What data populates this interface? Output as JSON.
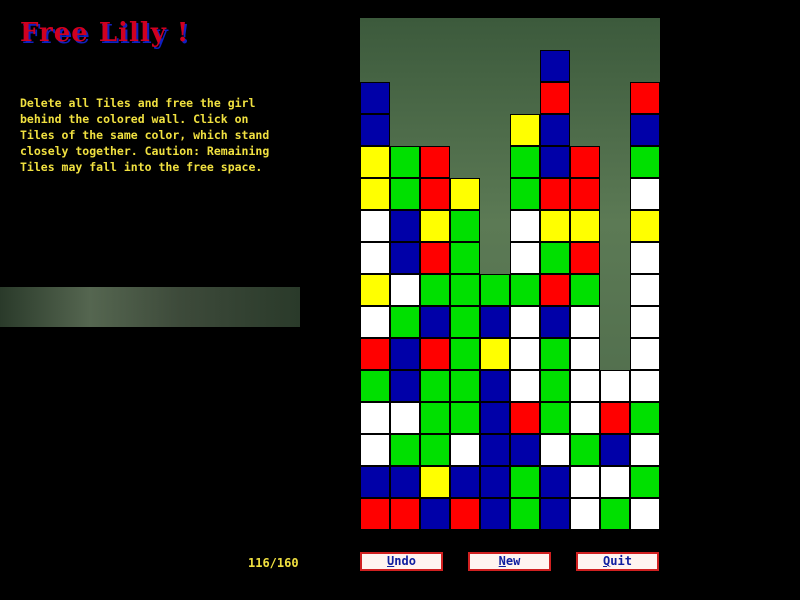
{
  "title": "Free Lilly !",
  "instructions": "Delete all Tiles and free the girl\nbehind the colored wall. Click on\nTiles of the same color, which stand\nclosely together. Caution: Remaining\nTiles may fall into the free space.",
  "counter": "116/160",
  "buttons": {
    "undo": {
      "hot": "U",
      "rest": "ndo"
    },
    "new": {
      "hot": "N",
      "rest": "ew"
    },
    "quit": {
      "hot": "Q",
      "rest": "uit"
    }
  },
  "colors": {
    "R": "#ff0000",
    "G": "#00e000",
    "B": "#0000a8",
    "Y": "#ffff00",
    "W": "#ffffff"
  },
  "grid": [
    "..........",
    "......B...",
    "B.....R..R",
    "B....YB..B",
    "YGR..GBR.G",
    "YGRY.GRR.W",
    "WBYG.WYY.Y",
    "WBRG.WGR.W",
    "YWGGGGRG.W",
    "WGBGBWBW.W",
    "RBRGYWGW.W",
    "GBGGBWGWWW",
    "WWGGBRGWRG",
    "WGGWBBWGBW",
    "BBYBBGBWWG",
    "RRBRBGBWGW"
  ]
}
